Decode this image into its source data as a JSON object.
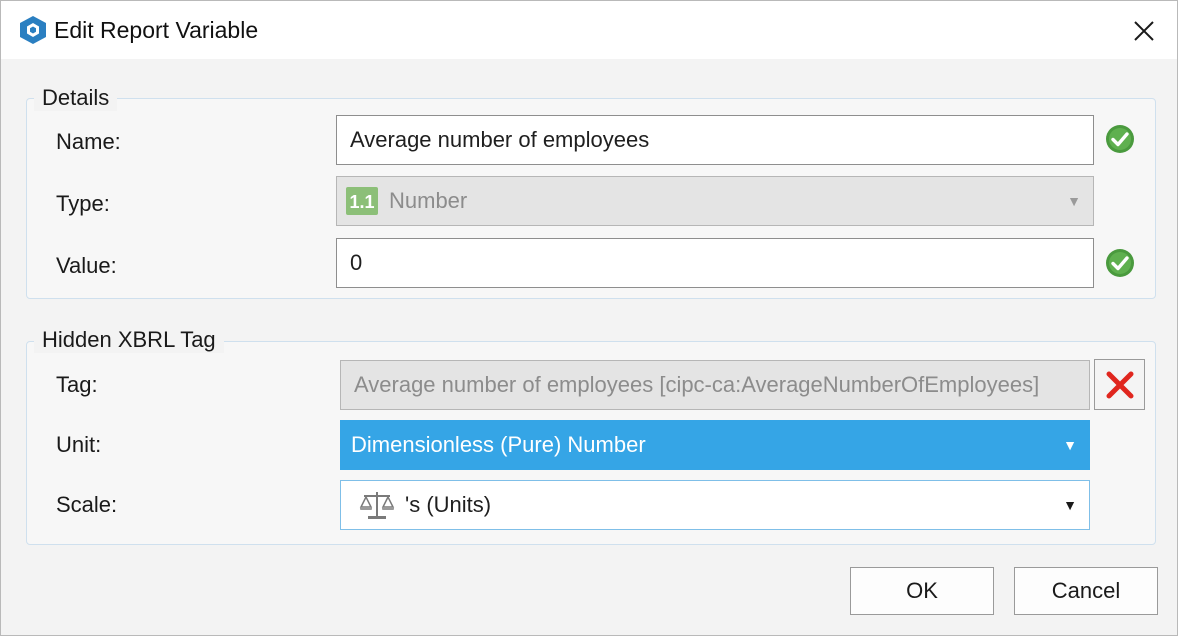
{
  "window": {
    "title": "Edit Report Variable"
  },
  "details": {
    "group_label": "Details",
    "name": {
      "label": "Name:",
      "value": "Average number of employees"
    },
    "type": {
      "label": "Type:",
      "value": "Number",
      "icon": "number-type-icon"
    },
    "value": {
      "label": "Value:",
      "value": "0"
    }
  },
  "xbrl": {
    "group_label": "Hidden XBRL Tag",
    "tag": {
      "label": "Tag:",
      "value": "Average number of employees [cipc-ca:AverageNumberOfEmployees]"
    },
    "unit": {
      "label": "Unit:",
      "value": "Dimensionless (Pure) Number"
    },
    "scale": {
      "label": "Scale:",
      "value": "'s (Units)",
      "icon": "scale-balance-icon"
    }
  },
  "buttons": {
    "ok": "OK",
    "cancel": "Cancel"
  },
  "colors": {
    "selection": "#35a5e6",
    "valid": "#4a9a3e",
    "delete": "#e0261e",
    "brand": "#1f6fb5"
  }
}
